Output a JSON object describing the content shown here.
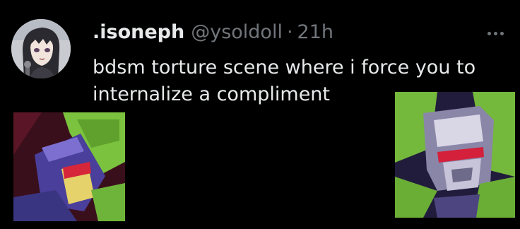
{
  "tweet": {
    "display_name": ".isoneph",
    "handle": "@ysoldoll",
    "separator": "·",
    "timestamp": "21h",
    "text": "bdsm torture scene where i force you to internalize a compliment"
  },
  "icons": {
    "more": "more-horizontal-icon"
  },
  "colors": {
    "background": "#000000",
    "primary_text": "#e7e9ea",
    "secondary_text": "#71767b"
  }
}
